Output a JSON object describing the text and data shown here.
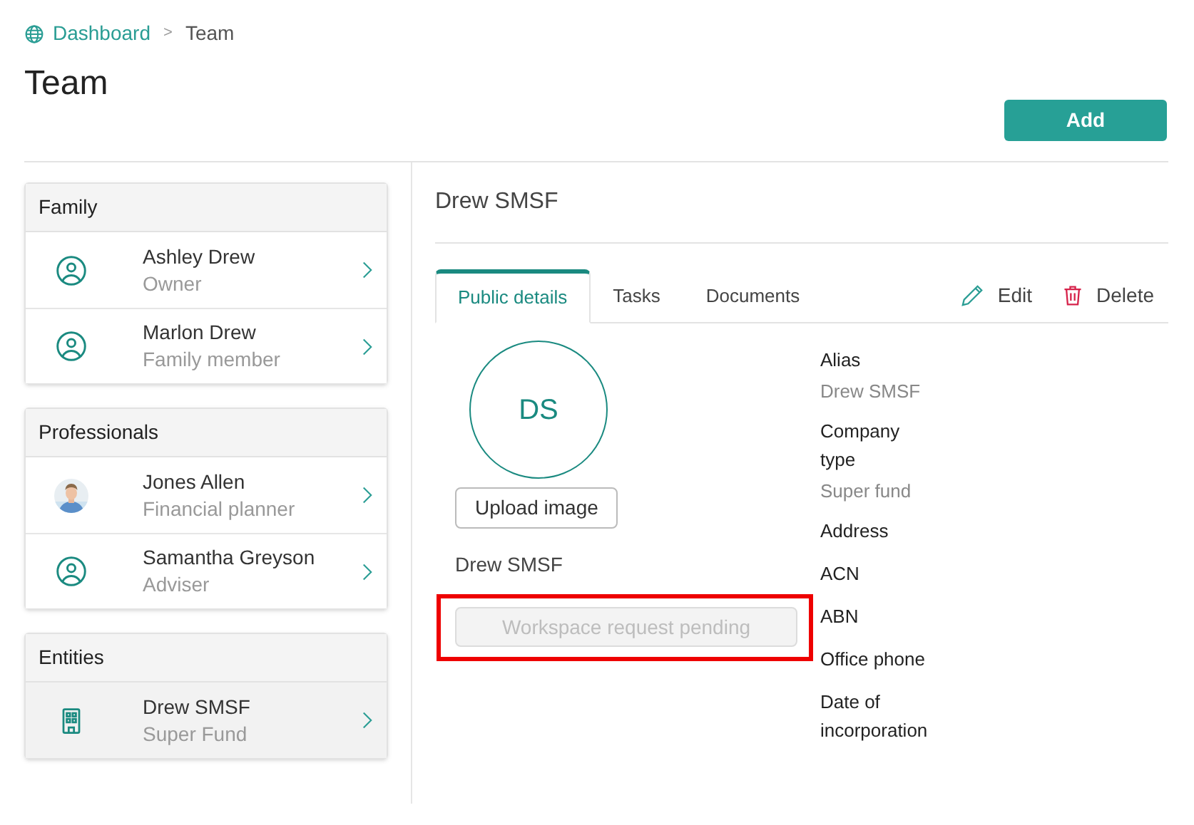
{
  "breadcrumb": [
    {
      "label": "Dashboard",
      "kind": "link"
    },
    {
      "label": "Team",
      "kind": "current"
    }
  ],
  "breadcrumb_separator": ">",
  "page_title": "Team",
  "add_button": "Add",
  "groups": [
    {
      "title": "Family",
      "items": [
        {
          "name": "Ashley Drew",
          "role": "Owner",
          "kind": "person",
          "selected": false
        },
        {
          "name": "Marlon Drew",
          "role": "Family member",
          "kind": "person",
          "selected": false
        }
      ]
    },
    {
      "title": "Professionals",
      "items": [
        {
          "name": "Jones Allen",
          "role": "Financial planner",
          "selected": false
        },
        {
          "name": "Samantha Greyson",
          "role": "Adviser",
          "kind": "person",
          "selected": false
        }
      ]
    },
    {
      "title": "Entities",
      "items": [
        {
          "name": "Drew SMSF",
          "role": "Super Fund",
          "kind": "building",
          "selected": true
        }
      ]
    }
  ],
  "detail": {
    "title": "Drew SMSF",
    "tabs": [
      {
        "label": "Public details",
        "selected": true
      },
      {
        "label": "Tasks",
        "selected": false
      },
      {
        "label": "Documents",
        "selected": false
      }
    ],
    "actions": [
      {
        "label": "Edit",
        "kind": "edit"
      },
      {
        "label": "Delete",
        "kind": "delete"
      }
    ],
    "initials": "DS",
    "upload_button": "Upload image",
    "entity_name": "Drew SMSF",
    "workspace_button": {
      "label": "Workspace request pending",
      "disabled": true,
      "highlighted": true
    },
    "fields": [
      {
        "label": "Alias",
        "value": "Drew SMSF"
      },
      {
        "label": "Company type",
        "value": "Super fund"
      },
      {
        "label": "Address"
      },
      {
        "label": "ACN"
      },
      {
        "label": "ABN"
      },
      {
        "label": "Office phone"
      },
      {
        "label": "Date of incorporation"
      }
    ]
  }
}
